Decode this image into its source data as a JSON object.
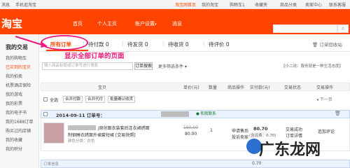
{
  "topbar": {
    "msg": "消息",
    "mobile": "手机逛淘宝",
    "home": "淘宝网首页",
    "my": "我的淘宝",
    "cart": "购物车1",
    "fav": "收藏夹",
    "cat": "商品分类",
    "seller": "卖家中心",
    "service": "联系客服"
  },
  "header": {
    "logo": "淘宝",
    "nav": [
      "首页",
      "个人主页",
      "账户设置",
      "消息"
    ],
    "settings_caret": "▾"
  },
  "sidebar": {
    "title": "我的交易",
    "items": [
      "我的购物车",
      "已买到的宝贝",
      "我的拍卖",
      "机票酒店保险",
      "我的游戏",
      "我的彩票",
      "我的电子书",
      "我的1688订单",
      "购买过的店铺",
      "我的收藏",
      "我的积分"
    ]
  },
  "tabs": {
    "items": [
      "所有订单",
      "待付款 0",
      "待发货 0",
      "待收货 0",
      "待评价 0"
    ],
    "recycle": "订单回收站"
  },
  "annotation": {
    "text": "显示全部订单的页面"
  },
  "search": {
    "placeholder": "输入商品标题或订单号进行搜索",
    "button": "订单搜索",
    "more": "更多筛选条件 ▾",
    "notice": "【小二说：服务就是一种生活态度】"
  },
  "table": {
    "headers": [
      "宝贝",
      "单价(元)",
      "数量",
      "商品操作",
      "实付款(元)",
      "交易状态",
      "交易操作"
    ]
  },
  "batch": {
    "select_all": "全选",
    "buttons": [
      "合并付款",
      "合并代付",
      "批量确认收货"
    ],
    "pager": "◂  下一页"
  },
  "order": {
    "date": "2014-09-11  订单号：",
    "contact": "● 和我联系",
    "delete_icon": "🗑",
    "title": "j原创跟衣装套后连衣裙绣面",
    "title2": "制钢睡衣绣面外裙套短裙 [交易快照]",
    "sku": "颜色分类：白色",
    "orig_price": "160.00",
    "price": "80.00",
    "qty": "1",
    "refund": "申请售后\n投诉卖家",
    "paid": "80.70",
    "shipping": "(含运费：0.70)",
    "status": "交易成功\n订单详情",
    "action": "追加评论"
  },
  "next_order": {
    "label": "订单信息",
    "price": "0.70"
  },
  "watermark": {
    "text": "广东龙网"
  }
}
